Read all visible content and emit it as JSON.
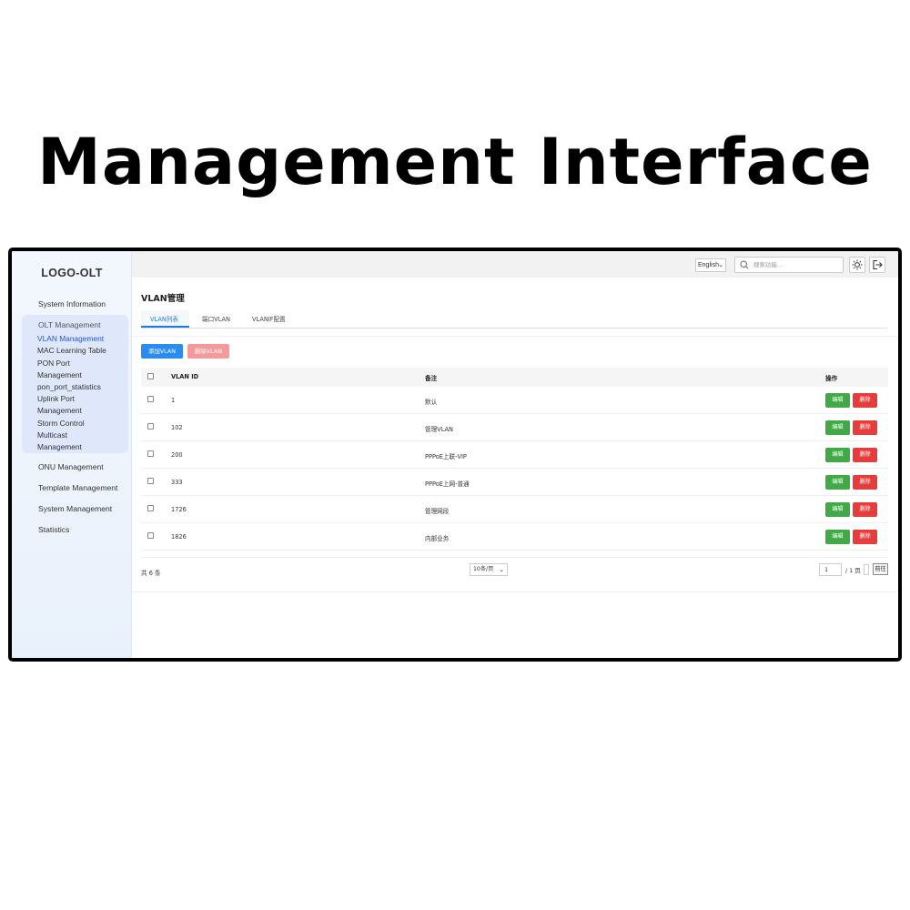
{
  "heading": "Management Interface",
  "sidebar": {
    "logo": "LOGO-OLT",
    "items": {
      "system_information": "System Information",
      "olt_management": "OLT Management",
      "onu_management": "ONU Management",
      "template_management": "Template Management",
      "system_management": "System Management",
      "statistics": "Statistics"
    },
    "olt_submenu": [
      "VLAN Management",
      "MAC Learning Table",
      "PON Port Management",
      "pon_port_statistics",
      "Uplink Port Management",
      "Storm Control",
      "Multicast Management"
    ],
    "active_item": "VLAN Management"
  },
  "topbar": {
    "language": "English",
    "search_placeholder": "搜索功能...",
    "icons": [
      "search-icon",
      "sun-icon",
      "logout-icon"
    ]
  },
  "content": {
    "title": "VLAN管理",
    "tabs": [
      "VLAN列表",
      "端口VLAN",
      "VLANIF配置"
    ],
    "active_tab": "VLAN列表",
    "add_button": "添加VLAN",
    "delete_button": "删除VLAN",
    "table": {
      "headers": {
        "vlan_id": "VLAN ID",
        "remark": "备注",
        "action": "操作"
      },
      "rows": [
        {
          "vlan_id": "1",
          "remark": "默认"
        },
        {
          "vlan_id": "102",
          "remark": "管理VLAN"
        },
        {
          "vlan_id": "200",
          "remark": "PPPoE上联-VIP"
        },
        {
          "vlan_id": "333",
          "remark": "PPPoE上网-普通"
        },
        {
          "vlan_id": "1726",
          "remark": "管理网段"
        },
        {
          "vlan_id": "1826",
          "remark": "内部业务"
        }
      ],
      "edit_label": "编辑",
      "delete_label": "删除"
    },
    "pagination": {
      "total": "共 6 条",
      "page_size": "10条/页",
      "current_page": "1",
      "of_pages": "/ 1 页",
      "go_label": "前往"
    }
  },
  "colors": {
    "primary": "#2a8cf0",
    "danger_light": "#f49a9a",
    "edit_green": "#43a948",
    "delete_red": "#e63c3c",
    "active_link": "#2455d8"
  }
}
